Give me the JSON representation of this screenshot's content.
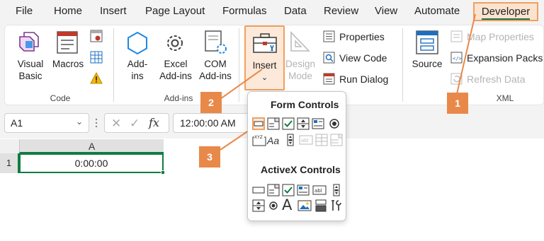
{
  "menu": {
    "tabs": [
      "File",
      "Home",
      "Insert",
      "Page Layout",
      "Formulas",
      "Data",
      "Review",
      "View",
      "Automate"
    ],
    "active_tab": "Developer"
  },
  "ribbon": {
    "code": {
      "visual_basic": [
        "Visual",
        "Basic"
      ],
      "macros": "Macros",
      "group_label": "Code"
    },
    "addins": {
      "addins": [
        "Add-",
        "ins"
      ],
      "excel_addins": [
        "Excel",
        "Add-ins"
      ],
      "com_addins": [
        "COM",
        "Add-ins"
      ],
      "group_label": "Add-ins"
    },
    "controls": {
      "insert": "Insert",
      "design_mode": [
        "Design",
        "Mode"
      ],
      "properties": "Properties",
      "view_code": "View Code",
      "run_dialog": "Run Dialog"
    },
    "xml": {
      "source": "Source",
      "map_properties": "Map Properties",
      "expansion_packs": "Expansion Packs",
      "refresh_data": "Refresh Data",
      "group_label": "XML"
    }
  },
  "formula_bar": {
    "name_box": "A1",
    "fx": "fx",
    "formula": "12:00:00 AM"
  },
  "grid": {
    "column_a": "A",
    "row_1": "1",
    "cell_a1": "0:00:00"
  },
  "dropdown": {
    "form_controls_title": "Form Controls",
    "activex_controls_title": "ActiveX Controls",
    "label_aa": "Aa",
    "label_xyz": "XYZ",
    "text_abl": "abl",
    "text_big_a": "A"
  },
  "callouts": [
    "1",
    "2",
    "3"
  ],
  "colors": {
    "accent_orange": "#e8894a",
    "excel_green": "#107c41",
    "highlight_fill": "#fde9d9"
  }
}
